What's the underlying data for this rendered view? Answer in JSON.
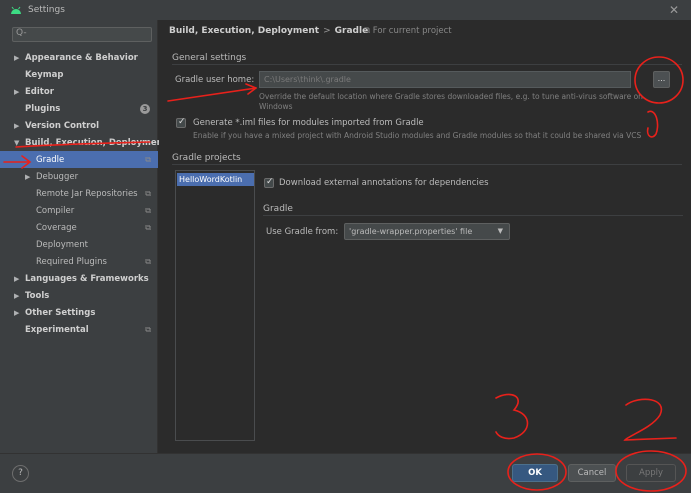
{
  "window": {
    "title": "Settings"
  },
  "search": {
    "glyph": "Q-"
  },
  "sidebar": {
    "items": [
      {
        "label": "Appearance & Behavior",
        "expandable": true
      },
      {
        "label": "Keymap",
        "expandable": false
      },
      {
        "label": "Editor",
        "expandable": true
      },
      {
        "label": "Plugins",
        "badge": "3"
      },
      {
        "label": "Version Control",
        "expandable": true
      },
      {
        "label": "Build, Execution, Deployment",
        "expanded": true
      },
      {
        "label": "Gradle",
        "selected": true
      },
      {
        "label": "Debugger",
        "expandable": true
      },
      {
        "label": "Remote Jar Repositories"
      },
      {
        "label": "Compiler"
      },
      {
        "label": "Coverage"
      },
      {
        "label": "Deployment"
      },
      {
        "label": "Required Plugins"
      },
      {
        "label": "Languages & Frameworks",
        "expandable": true
      },
      {
        "label": "Tools",
        "expandable": true
      },
      {
        "label": "Other Settings",
        "expandable": true
      },
      {
        "label": "Experimental"
      }
    ]
  },
  "header": {
    "crumb1": "Build, Execution, Deployment",
    "crumb_sep": ">",
    "crumb2": "Gradle",
    "scope": "For current project"
  },
  "general": {
    "title": "General settings",
    "user_home_label": "Gradle user home:",
    "user_home_value": "C:\\Users\\think\\.gradle",
    "browse_label": "...",
    "hint_line1": "Override the default location where Gradle stores downloaded files, e.g. to tune anti-virus software on",
    "hint_line2": "Windows",
    "generate_iml_label": "Generate *.iml files for modules imported from Gradle",
    "generate_iml_hint": "Enable if you have a mixed project with Android Studio modules and Gradle modules so that it could be shared via VCS"
  },
  "projects": {
    "title": "Gradle projects",
    "items": [
      "HelloWordKotlin"
    ],
    "download_annotations_label": "Download external annotations for dependencies",
    "gradle_section": "Gradle",
    "use_gradle_from_label": "Use Gradle from:",
    "use_gradle_from_value": "'gradle-wrapper.properties' file"
  },
  "footer": {
    "help": "?",
    "ok": "OK",
    "cancel": "Cancel",
    "apply": "Apply"
  },
  "annotations": {
    "numbers": [
      "1",
      "2",
      "3"
    ],
    "color": "#e8211b"
  },
  "colors": {
    "selection": "#4b6eaf",
    "primary_button": "#365880"
  }
}
